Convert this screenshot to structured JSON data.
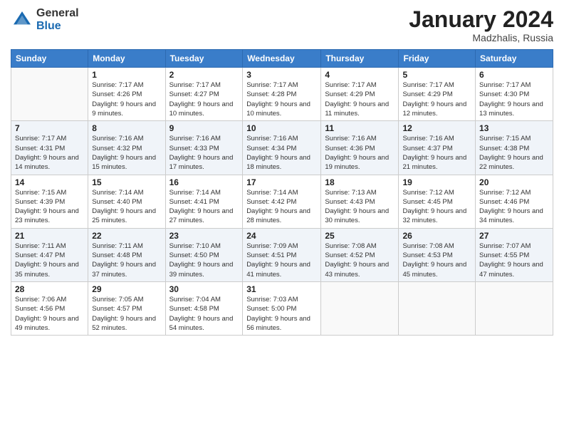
{
  "logo": {
    "general": "General",
    "blue": "Blue"
  },
  "title": {
    "month": "January 2024",
    "location": "Madzhalis, Russia"
  },
  "weekdays": [
    "Sunday",
    "Monday",
    "Tuesday",
    "Wednesday",
    "Thursday",
    "Friday",
    "Saturday"
  ],
  "weeks": [
    [
      {
        "day": "",
        "sunrise": "",
        "sunset": "",
        "daylight": ""
      },
      {
        "day": "1",
        "sunrise": "Sunrise: 7:17 AM",
        "sunset": "Sunset: 4:26 PM",
        "daylight": "Daylight: 9 hours and 9 minutes."
      },
      {
        "day": "2",
        "sunrise": "Sunrise: 7:17 AM",
        "sunset": "Sunset: 4:27 PM",
        "daylight": "Daylight: 9 hours and 10 minutes."
      },
      {
        "day": "3",
        "sunrise": "Sunrise: 7:17 AM",
        "sunset": "Sunset: 4:28 PM",
        "daylight": "Daylight: 9 hours and 10 minutes."
      },
      {
        "day": "4",
        "sunrise": "Sunrise: 7:17 AM",
        "sunset": "Sunset: 4:29 PM",
        "daylight": "Daylight: 9 hours and 11 minutes."
      },
      {
        "day": "5",
        "sunrise": "Sunrise: 7:17 AM",
        "sunset": "Sunset: 4:29 PM",
        "daylight": "Daylight: 9 hours and 12 minutes."
      },
      {
        "day": "6",
        "sunrise": "Sunrise: 7:17 AM",
        "sunset": "Sunset: 4:30 PM",
        "daylight": "Daylight: 9 hours and 13 minutes."
      }
    ],
    [
      {
        "day": "7",
        "sunrise": "Sunrise: 7:17 AM",
        "sunset": "Sunset: 4:31 PM",
        "daylight": "Daylight: 9 hours and 14 minutes."
      },
      {
        "day": "8",
        "sunrise": "Sunrise: 7:16 AM",
        "sunset": "Sunset: 4:32 PM",
        "daylight": "Daylight: 9 hours and 15 minutes."
      },
      {
        "day": "9",
        "sunrise": "Sunrise: 7:16 AM",
        "sunset": "Sunset: 4:33 PM",
        "daylight": "Daylight: 9 hours and 17 minutes."
      },
      {
        "day": "10",
        "sunrise": "Sunrise: 7:16 AM",
        "sunset": "Sunset: 4:34 PM",
        "daylight": "Daylight: 9 hours and 18 minutes."
      },
      {
        "day": "11",
        "sunrise": "Sunrise: 7:16 AM",
        "sunset": "Sunset: 4:36 PM",
        "daylight": "Daylight: 9 hours and 19 minutes."
      },
      {
        "day": "12",
        "sunrise": "Sunrise: 7:16 AM",
        "sunset": "Sunset: 4:37 PM",
        "daylight": "Daylight: 9 hours and 21 minutes."
      },
      {
        "day": "13",
        "sunrise": "Sunrise: 7:15 AM",
        "sunset": "Sunset: 4:38 PM",
        "daylight": "Daylight: 9 hours and 22 minutes."
      }
    ],
    [
      {
        "day": "14",
        "sunrise": "Sunrise: 7:15 AM",
        "sunset": "Sunset: 4:39 PM",
        "daylight": "Daylight: 9 hours and 23 minutes."
      },
      {
        "day": "15",
        "sunrise": "Sunrise: 7:14 AM",
        "sunset": "Sunset: 4:40 PM",
        "daylight": "Daylight: 9 hours and 25 minutes."
      },
      {
        "day": "16",
        "sunrise": "Sunrise: 7:14 AM",
        "sunset": "Sunset: 4:41 PM",
        "daylight": "Daylight: 9 hours and 27 minutes."
      },
      {
        "day": "17",
        "sunrise": "Sunrise: 7:14 AM",
        "sunset": "Sunset: 4:42 PM",
        "daylight": "Daylight: 9 hours and 28 minutes."
      },
      {
        "day": "18",
        "sunrise": "Sunrise: 7:13 AM",
        "sunset": "Sunset: 4:43 PM",
        "daylight": "Daylight: 9 hours and 30 minutes."
      },
      {
        "day": "19",
        "sunrise": "Sunrise: 7:12 AM",
        "sunset": "Sunset: 4:45 PM",
        "daylight": "Daylight: 9 hours and 32 minutes."
      },
      {
        "day": "20",
        "sunrise": "Sunrise: 7:12 AM",
        "sunset": "Sunset: 4:46 PM",
        "daylight": "Daylight: 9 hours and 34 minutes."
      }
    ],
    [
      {
        "day": "21",
        "sunrise": "Sunrise: 7:11 AM",
        "sunset": "Sunset: 4:47 PM",
        "daylight": "Daylight: 9 hours and 35 minutes."
      },
      {
        "day": "22",
        "sunrise": "Sunrise: 7:11 AM",
        "sunset": "Sunset: 4:48 PM",
        "daylight": "Daylight: 9 hours and 37 minutes."
      },
      {
        "day": "23",
        "sunrise": "Sunrise: 7:10 AM",
        "sunset": "Sunset: 4:50 PM",
        "daylight": "Daylight: 9 hours and 39 minutes."
      },
      {
        "day": "24",
        "sunrise": "Sunrise: 7:09 AM",
        "sunset": "Sunset: 4:51 PM",
        "daylight": "Daylight: 9 hours and 41 minutes."
      },
      {
        "day": "25",
        "sunrise": "Sunrise: 7:08 AM",
        "sunset": "Sunset: 4:52 PM",
        "daylight": "Daylight: 9 hours and 43 minutes."
      },
      {
        "day": "26",
        "sunrise": "Sunrise: 7:08 AM",
        "sunset": "Sunset: 4:53 PM",
        "daylight": "Daylight: 9 hours and 45 minutes."
      },
      {
        "day": "27",
        "sunrise": "Sunrise: 7:07 AM",
        "sunset": "Sunset: 4:55 PM",
        "daylight": "Daylight: 9 hours and 47 minutes."
      }
    ],
    [
      {
        "day": "28",
        "sunrise": "Sunrise: 7:06 AM",
        "sunset": "Sunset: 4:56 PM",
        "daylight": "Daylight: 9 hours and 49 minutes."
      },
      {
        "day": "29",
        "sunrise": "Sunrise: 7:05 AM",
        "sunset": "Sunset: 4:57 PM",
        "daylight": "Daylight: 9 hours and 52 minutes."
      },
      {
        "day": "30",
        "sunrise": "Sunrise: 7:04 AM",
        "sunset": "Sunset: 4:58 PM",
        "daylight": "Daylight: 9 hours and 54 minutes."
      },
      {
        "day": "31",
        "sunrise": "Sunrise: 7:03 AM",
        "sunset": "Sunset: 5:00 PM",
        "daylight": "Daylight: 9 hours and 56 minutes."
      },
      {
        "day": "",
        "sunrise": "",
        "sunset": "",
        "daylight": ""
      },
      {
        "day": "",
        "sunrise": "",
        "sunset": "",
        "daylight": ""
      },
      {
        "day": "",
        "sunrise": "",
        "sunset": "",
        "daylight": ""
      }
    ]
  ]
}
